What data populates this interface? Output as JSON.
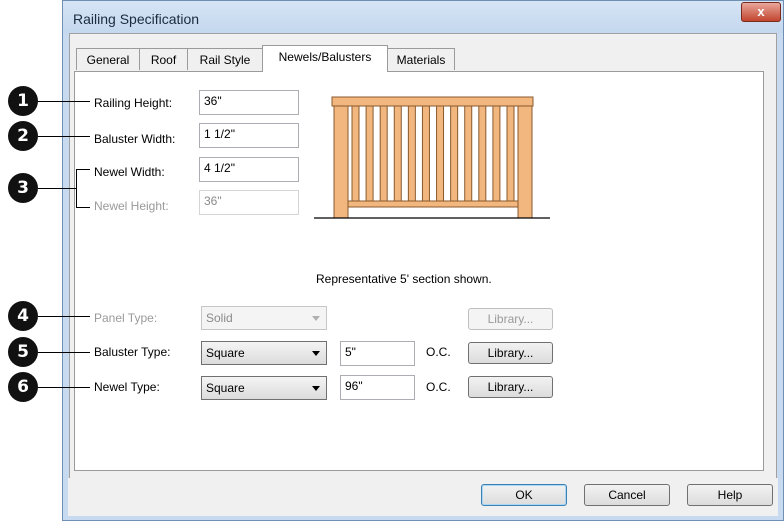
{
  "window": {
    "title": "Railing Specification",
    "close_label": "x"
  },
  "tabs": [
    {
      "label": "General"
    },
    {
      "label": "Roof"
    },
    {
      "label": "Rail Style"
    },
    {
      "label": "Newels/Balusters"
    },
    {
      "label": "Materials"
    }
  ],
  "active_tab": "Newels/Balusters",
  "callouts": [
    "1",
    "2",
    "3",
    "4",
    "5",
    "6"
  ],
  "fields": {
    "railing_height": {
      "label": "Railing Height:",
      "value": "36\""
    },
    "baluster_width": {
      "label": "Baluster Width:",
      "value": "1 1/2\""
    },
    "newel_width": {
      "label": "Newel Width:",
      "value": "4 1/2\""
    },
    "newel_height": {
      "label": "Newel Height:",
      "value": "36\""
    }
  },
  "preview_caption": "Representative 5' section shown.",
  "panel_type": {
    "label": "Panel Type:",
    "value": "Solid",
    "library_label": "Library..."
  },
  "baluster_type": {
    "label": "Baluster Type:",
    "value": "Square",
    "spacing": "5\"",
    "oc": "O.C.",
    "library_label": "Library..."
  },
  "newel_type": {
    "label": "Newel Type:",
    "value": "Square",
    "spacing": "96\"",
    "oc": "O.C.",
    "library_label": "Library..."
  },
  "buttons": {
    "ok": "OK",
    "cancel": "Cancel",
    "help": "Help"
  },
  "colors": {
    "wood_fill": "#f2b67f",
    "wood_stroke": "#8a5a2c",
    "title_bar": "#c7daf0"
  }
}
